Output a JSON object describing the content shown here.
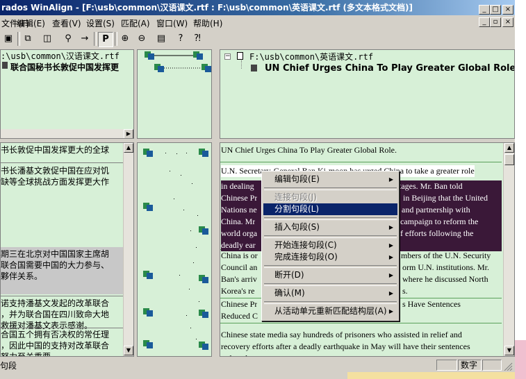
{
  "window": {
    "title": "rados WinAlign - [F:\\usb\\common\\汉语课文.rtf : F:\\usb\\common\\英语课文.rtf (多文本格式文档)]"
  },
  "menu": [
    "文件(F)",
    "编辑(E)",
    "查看(V)",
    "设置(S)",
    "匹配(A)",
    "窗口(W)",
    "帮助(H)"
  ],
  "toolbar": {
    "p_label": "P"
  },
  "source_tree": {
    "file": ":\\usb\\common\\汉语课文.rtf",
    "doc_title": "联合国秘书长敦促中国发挥更"
  },
  "target_tree": {
    "file": "F:\\usb\\common\\英语课文.rtf",
    "doc_title": "UN Chief Urges China To Play Greater Global Role."
  },
  "source_segments": [
    "书长敦促中国发挥更大的全球",
    "书长潘基文敦促中国在应对饥",
    "缺等全球挑战方面发挥更大作",
    "期三在北京对中国国家主席胡",
    "联合国需要中国的大力参与、",
    "夥伴关系。",
    "诺支持潘基文发起的改革联合",
    "，并为联合国在四川致命大地",
    "救援对潘基文表示感谢。",
    "合国五个拥有否决权的常任理",
    "，因此中国的支持对改革联合",
    "努力至关重要。"
  ],
  "target_segments": [
    [
      "UN Chief Urges China To Play Greater Global Role."
    ],
    [
      "U.N. Secretary-General Ban Ki-moon has urged China to take a greater role",
      "in dealing",
      "Chinese Pr",
      "Nations ne",
      "China.  Mr",
      "world orga",
      "deadly ear"
    ],
    [
      "China is or",
      "Council an",
      "Ban's arriv",
      "Korea's re"
    ],
    [
      "Chinese Pr",
      "Reduced C"
    ],
    [
      "Chinese state media say hundreds of prisoners who assisted in relief and",
      "recovery efforts after a deadly earthquake in May will have their sentences",
      "reduced"
    ]
  ],
  "target_segment_tails": {
    "seg2_line2": "hortages.  Mr. Ban told",
    "seg2_line3": "in Beijing that the United",
    "seg2_line4": "and partnership with",
    "seg2_line5": "campaign to reform the",
    "seg2_line6": "f efforts following the",
    "seg3_line1": "mbers of the U.N. Security",
    "seg3_line2": "orm U.N. institutions. Mr.",
    "seg3_line3": "where he discussed North",
    "seg3_line4": "s.",
    "seg4_line1": "s Have Sentences"
  },
  "context_menu": [
    {
      "label": "编辑句段(E)",
      "submenu": true,
      "disabled": false,
      "hover": false
    },
    {
      "sep": true
    },
    {
      "label": "连接句段(J)",
      "submenu": false,
      "disabled": true,
      "hover": false
    },
    {
      "label": "分割句段(L)",
      "submenu": false,
      "disabled": false,
      "hover": true
    },
    {
      "sep": true
    },
    {
      "label": "插入句段(S)",
      "submenu": true,
      "disabled": false,
      "hover": false
    },
    {
      "sep": true
    },
    {
      "label": "开始连接句段(C)",
      "submenu": true,
      "disabled": false,
      "hover": false
    },
    {
      "label": "完成连接句段(O)",
      "submenu": true,
      "disabled": false,
      "hover": false
    },
    {
      "sep": true
    },
    {
      "label": "断开(D)",
      "submenu": true,
      "disabled": false,
      "hover": false
    },
    {
      "sep": true
    },
    {
      "label": "确认(M)",
      "submenu": true,
      "disabled": false,
      "hover": false
    },
    {
      "sep": true
    },
    {
      "label": "从活动单元重新匹配结构层(A)",
      "submenu": true,
      "disabled": false,
      "hover": false
    }
  ],
  "status": {
    "left": "句段",
    "num": "数字"
  },
  "colors": {
    "pane_bg": "#d7f0d7",
    "title_start": "#0a246a",
    "selected_segment": "#3a1838",
    "menu_highlight": "#0a246a"
  }
}
